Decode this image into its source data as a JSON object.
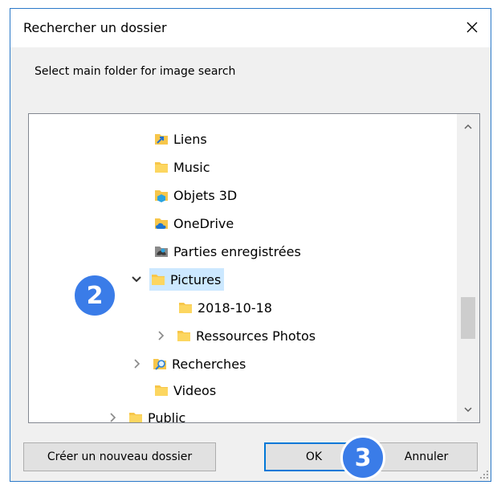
{
  "dialog": {
    "title": "Rechercher un dossier",
    "instruction": "Select main folder for image search",
    "accent_color": "#2b79c9"
  },
  "tree": {
    "nodes": [
      {
        "label": "Liens",
        "icon": "links-folder-icon"
      },
      {
        "label": "Music",
        "icon": "folder-icon"
      },
      {
        "label": "Objets 3D",
        "icon": "3d-objects-folder-icon"
      },
      {
        "label": "OneDrive",
        "icon": "onedrive-folder-icon"
      },
      {
        "label": "Parties enregistrées",
        "icon": "saved-games-folder-icon"
      },
      {
        "label": "Pictures",
        "icon": "folder-icon",
        "expanded": true,
        "selected": true
      },
      {
        "label": "2018-10-18",
        "icon": "folder-icon"
      },
      {
        "label": "Ressources Photos",
        "icon": "folder-icon",
        "collapsed": true
      },
      {
        "label": "Recherches",
        "icon": "searches-folder-icon",
        "collapsed": true
      },
      {
        "label": "Videos",
        "icon": "folder-icon"
      },
      {
        "label": "Public",
        "icon": "folder-icon",
        "collapsed": true
      }
    ],
    "selection_color": "#cce8ff"
  },
  "buttons": {
    "new_folder": "Créer un nouveau dossier",
    "ok": "OK",
    "cancel": "Annuler"
  },
  "badges": {
    "step2": "2",
    "step3": "3",
    "color": "#3a7ce8"
  }
}
